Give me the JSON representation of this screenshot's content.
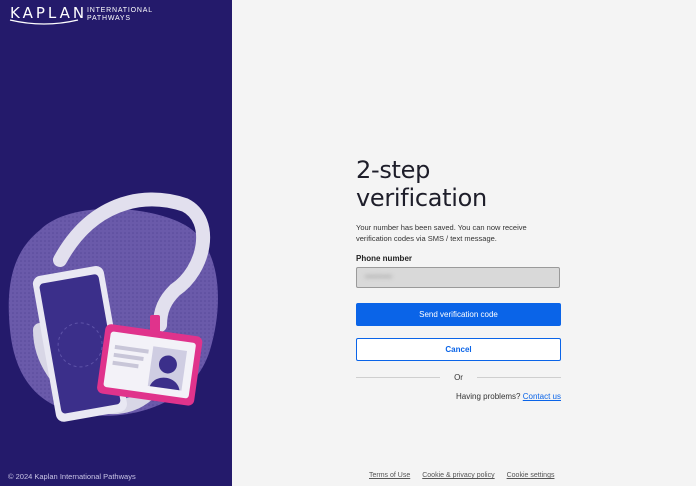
{
  "brand": {
    "logo_text": "KAPLAN",
    "logo_sub_line1": "INTERNATIONAL",
    "logo_sub_line2": "PATHWAYS"
  },
  "left_panel": {
    "copyright": "© 2024 Kaplan International Pathways",
    "illustration": "phone-and-id-badge-illustration",
    "background_color": "#241a6b"
  },
  "form": {
    "title": "2-step verification",
    "description": "Your number has been saved. You can now receive verification codes via SMS / text message.",
    "phone_label": "Phone number",
    "phone_value": "•••••••••••",
    "send_button": "Send verification code",
    "cancel_button": "Cancel",
    "or_text": "Or",
    "help_text": "Having problems?",
    "contact_link": "Contact us"
  },
  "footer": {
    "links": [
      "Terms of Use",
      "Cookie & privacy policy",
      "Cookie settings"
    ]
  },
  "colors": {
    "primary": "#0a64e8",
    "panel": "#241a6b",
    "badge_accent": "#e0338c"
  }
}
